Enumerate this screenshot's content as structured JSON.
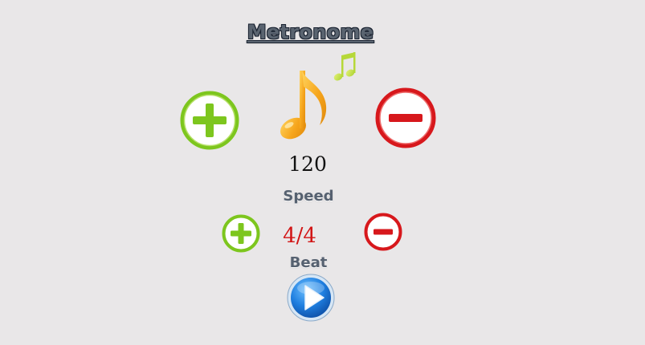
{
  "title": "Metronome",
  "tempo": {
    "value": "120",
    "label": "Speed"
  },
  "beat": {
    "value": "4/4",
    "label": "Beat"
  },
  "icons": {
    "tempo_increase": "plus-icon",
    "tempo_decrease": "minus-icon",
    "beat_increase": "plus-icon",
    "beat_decrease": "minus-icon",
    "music_note": "music-note-icon",
    "play": "play-icon"
  },
  "colors": {
    "background": "#e9e7e8",
    "increase": "#7dc61e",
    "decrease": "#d7181c",
    "note": "#f5a81e",
    "small_note": "#c6e24a",
    "play": "#1a76d6",
    "beat_text": "#d21515"
  }
}
